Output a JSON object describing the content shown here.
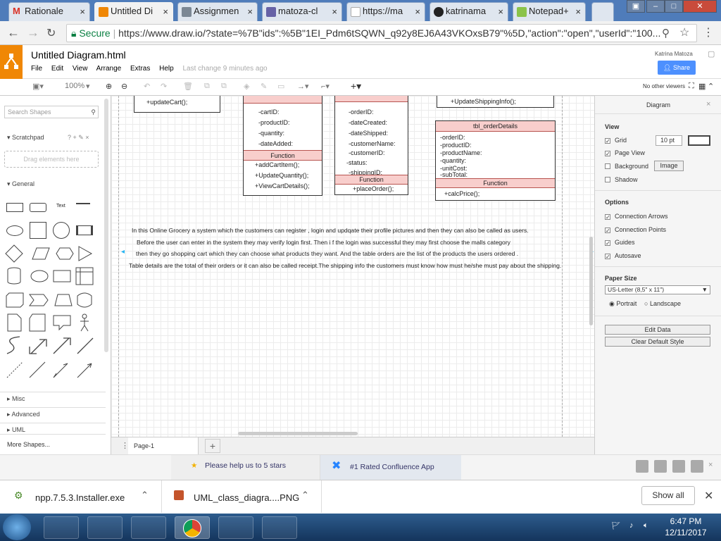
{
  "browser": {
    "tabs": [
      {
        "label": "Rationale",
        "icon": "gmail-icon",
        "color": "#d93025"
      },
      {
        "label": "Untitled Di",
        "icon": "drawio-icon",
        "color": "#f08705"
      },
      {
        "label": "Assignmen",
        "icon": "doc-icon",
        "color": "#7b8794"
      },
      {
        "label": "matoza-cl",
        "icon": "heroku-icon",
        "color": "#6762a6"
      },
      {
        "label": "https://ma",
        "icon": "page-icon",
        "color": "#aaaaaa"
      },
      {
        "label": "katrinama",
        "icon": "github-icon",
        "color": "#222222"
      },
      {
        "label": "Notepad+",
        "icon": "notepad-icon",
        "color": "#8bc34a"
      }
    ],
    "secure_label": "Secure",
    "url": "https://www.draw.io/?state=%7B\"ids\":%5B\"1EI_Pdm6tSQWN_q92y8EJ6A43VKOxsB79\"%5D,\"action\":\"open\",\"userId\":\"100..."
  },
  "app": {
    "file_title": "Untitled Diagram.html",
    "menus": [
      "File",
      "Edit",
      "View",
      "Arrange",
      "Extras",
      "Help"
    ],
    "last_change": "Last change 9 minutes ago",
    "user": "Katrina Matoza",
    "share_label": "Share",
    "zoom": "100%",
    "no_viewers": "No other viewers"
  },
  "left_panel": {
    "search_placeholder": "Search Shapes",
    "scratchpad": "Scratchpad",
    "scratchpad_icons": "? + ✎ ×",
    "drag_hint": "Drag elements here",
    "general": "General",
    "text_shape": "Text",
    "sections": [
      "Misc",
      "Advanced",
      "UML"
    ],
    "more_shapes": "More Shapes..."
  },
  "diagram": {
    "class1_lines": [
      "+updateCart();"
    ],
    "class2_attrs": [
      "-cartID:",
      "-productID:",
      " -quantity:",
      "-dateAdded:"
    ],
    "class2_fn_header": "Function",
    "class2_fns": [
      "+addCartItem();",
      "+UpdateQuantity();",
      "+ViewCartDetails();"
    ],
    "class3_attrs": [
      "-orderID:",
      "-dateCreated:",
      "-dateShipped:",
      "-customerName:",
      "-customerID:",
      "-status:",
      "-shippingID:"
    ],
    "class3_fn_header": "Function",
    "class3_fns": [
      "+placeOrder();"
    ],
    "class4_lines": [
      "+UpdateShippingInfo();"
    ],
    "class5_title": "tbl_orderDetails",
    "class5_attrs": [
      "-orderID:",
      "-productID:",
      "-productName:",
      " -quantity:",
      "-unitCost:",
      " -subTotal:"
    ],
    "class5_fn_header": "Function",
    "class5_fns": [
      "+calcPrice();"
    ],
    "description": [
      "In this Online Grocery a system which the customers can register , login and updqate their profile pictures and then they can also be called as users.",
      "Before the user can enter in the system they may verify login first.  Then i f the login was successful  they may first choose the malls category",
      "then they go shopping cart which they can choose what products they want. And the table orders are the list of the products the users ordered .",
      "Table details are the total of their orders or it can also be called receipt.The shipping info the customers must know how must he/she must pay about the shipping."
    ]
  },
  "page_bar": {
    "page": "Page-1"
  },
  "right_panel": {
    "title": "Diagram",
    "view": "View",
    "grid": "Grid",
    "grid_size": "10 pt",
    "page_view": "Page View",
    "background": "Background",
    "image_btn": "Image",
    "shadow": "Shadow",
    "options": "Options",
    "connection_arrows": "Connection Arrows",
    "connection_points": "Connection Points",
    "guides": "Guides",
    "autosave": "Autosave",
    "paper_size": "Paper Size",
    "paper_value": "US-Letter (8,5\" x 11\")",
    "portrait": "Portrait",
    "landscape": "Landscape",
    "edit_data": "Edit Data",
    "clear_style": "Clear Default Style"
  },
  "footer": {
    "rate": "Please help us to 5 stars",
    "confluence": "#1 Rated Confluence App"
  },
  "downloads": {
    "file1": "npp.7.5.3.Installer.exe",
    "file2": "UML_class_diagra....PNG",
    "show_all": "Show all"
  },
  "taskbar": {
    "time": "6:47 PM",
    "date": "12/11/2017"
  }
}
